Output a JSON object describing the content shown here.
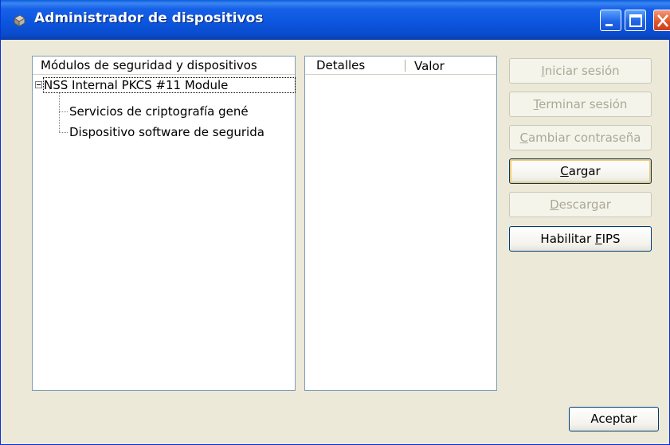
{
  "window": {
    "title": "Administrador de dispositivos"
  },
  "left_panel": {
    "header": "Módulos de seguridad y dispositivos",
    "tree": {
      "root": "NSS Internal PKCS #11 Module",
      "children": [
        "Servicios de criptografía gené",
        "Dispositivo software de segurida"
      ]
    }
  },
  "details_panel": {
    "columns": [
      "Detalles",
      "Valor"
    ]
  },
  "buttons": {
    "login": {
      "pre": "",
      "key": "I",
      "post": "niciar sesión",
      "enabled": false
    },
    "logout": {
      "pre": "",
      "key": "T",
      "post": "erminar sesión",
      "enabled": false
    },
    "change_password": {
      "pre": "",
      "key": "C",
      "post": "ambiar contraseña",
      "enabled": false
    },
    "load": {
      "pre": "",
      "key": "C",
      "post": "argar",
      "enabled": true
    },
    "unload": {
      "pre": "",
      "key": "D",
      "post": "escargar",
      "enabled": false
    },
    "enable_fips": {
      "pre": "Habilitar ",
      "key": "F",
      "post": "IPS",
      "enabled": true
    },
    "ok": {
      "pre": "",
      "key": "",
      "post": "Aceptar",
      "enabled": true
    }
  },
  "colors": {
    "titlebar": "#0a54dd",
    "disabled_text": "#aca899",
    "focus_border": "#f0c873"
  }
}
